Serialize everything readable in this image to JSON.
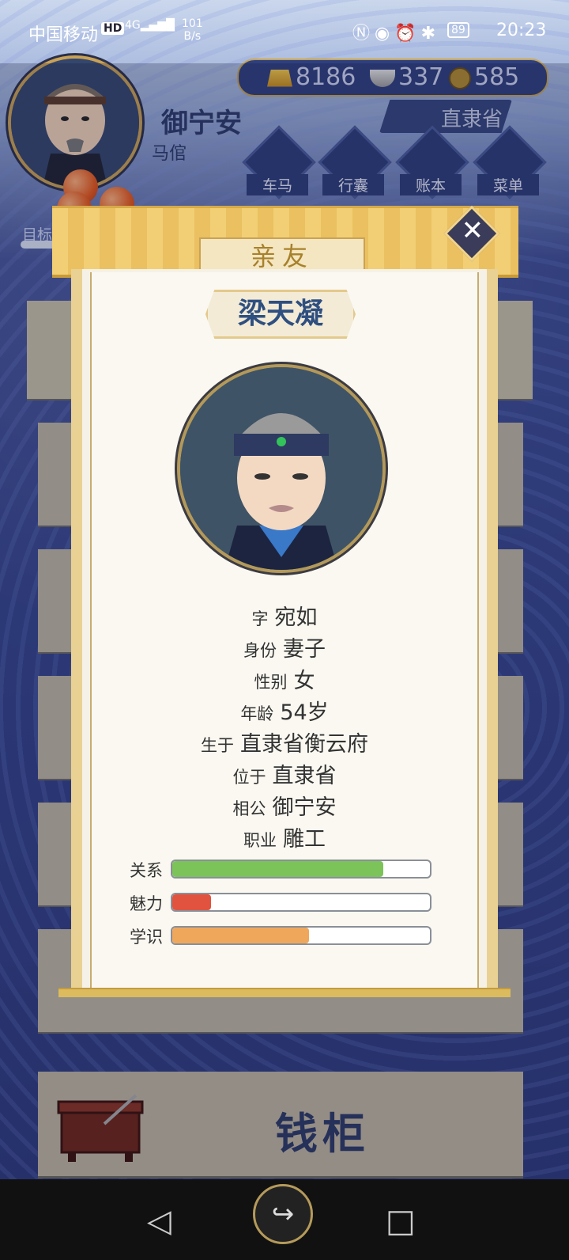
{
  "status_bar": {
    "carrier": "中国移动",
    "net_badge": "HD",
    "signal": "4G",
    "speed_value": "101",
    "speed_unit": "B/s",
    "battery": "89",
    "time": "20:23"
  },
  "player": {
    "name": "御宁安",
    "title": "马倌",
    "province": "直隶省"
  },
  "resources": {
    "gold": "8186",
    "silver": "337",
    "coin": "585"
  },
  "nav": [
    {
      "label": "车马",
      "icon": "carriage-icon"
    },
    {
      "label": "行囊",
      "icon": "bag-icon"
    },
    {
      "label": "账本",
      "icon": "ledger-icon"
    },
    {
      "label": "菜单",
      "icon": "menu-icon"
    }
  ],
  "goal_label": "目标",
  "dialog": {
    "tab_title": "亲友",
    "name": "梁天凝",
    "fields": [
      {
        "key": "字",
        "value": "宛如"
      },
      {
        "key": "身份",
        "value": "妻子"
      },
      {
        "key": "性别",
        "value": "女"
      },
      {
        "key": "年龄",
        "value": "54岁"
      },
      {
        "key": "生于",
        "value": "直隶省衡云府"
      },
      {
        "key": "位于",
        "value": "直隶省"
      },
      {
        "key": "相公",
        "value": "御宁安"
      },
      {
        "key": "职业",
        "value": "雕工"
      }
    ],
    "stats": [
      {
        "label": "关系",
        "value": 0.82,
        "color": "#7cc35a"
      },
      {
        "label": "魅力",
        "value": 0.15,
        "color": "#e1533e"
      },
      {
        "label": "学识",
        "value": 0.53,
        "color": "#efa75c"
      }
    ]
  },
  "money_chest_label": "钱柜"
}
